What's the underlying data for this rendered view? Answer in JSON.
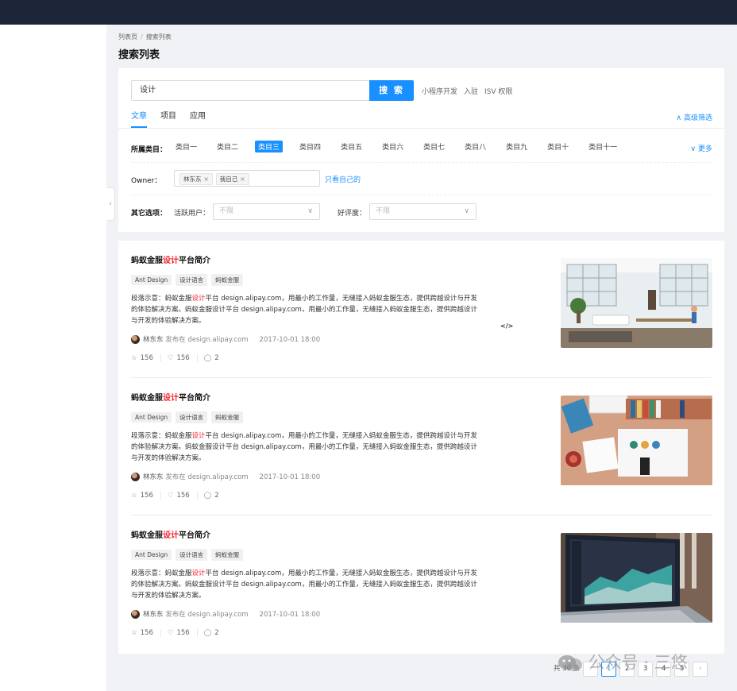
{
  "breadcrumb": [
    "列表页",
    "搜索列表"
  ],
  "page_title": "搜索列表",
  "search": {
    "value": "设计",
    "button": "搜 索"
  },
  "quick_links": [
    "小程序开发",
    "入驻",
    "ISV 权限"
  ],
  "tabs": [
    {
      "label": "文章",
      "active": true
    },
    {
      "label": "项目",
      "active": false
    },
    {
      "label": "应用",
      "active": false
    }
  ],
  "advanced_filter": "高级筛选",
  "filters": {
    "category_label": "所属类目：",
    "categories": [
      "类目一",
      "类目二",
      "类目三",
      "类目四",
      "类目五",
      "类目六",
      "类目七",
      "类目八",
      "类目九",
      "类目十",
      "类目十一"
    ],
    "selected_category": "类目三",
    "more": "更多",
    "owner_label": "Owner：",
    "owners": [
      "林东东",
      "我自己"
    ],
    "only_mine": "只看自己的",
    "other_label": "其它选项：",
    "active_user_label": "活跃用户：",
    "active_user_placeholder": "不限",
    "rating_label": "好评度：",
    "rating_placeholder": "不限"
  },
  "articles": [
    {
      "title_pre": "蚂蚁金服",
      "title_hl": "设计",
      "title_post": "平台简介",
      "tags": [
        "Ant Design",
        "设计语言",
        "蚂蚁金服"
      ],
      "desc_pre": "段落示意：蚂蚁金服",
      "desc_hl": "设计",
      "desc_post": "平台 design.alipay.com，用最小的工作量，无缝接入蚂蚁金服生态，提供跨越设计与开发的体验解决方案。蚂蚁金服设计平台 design.alipay.com，用最小的工作量，无缝接入蚂蚁金服生态，提供跨越设计与开发的体验解决方案。",
      "author": "林东东",
      "published": "发布在 design.alipay.com",
      "date": "2017-10-01 18:00",
      "stars": "156",
      "likes": "156",
      "comments": "2"
    },
    {
      "title_pre": "蚂蚁金服",
      "title_hl": "设计",
      "title_post": "平台简介",
      "tags": [
        "Ant Design",
        "设计语言",
        "蚂蚁金服"
      ],
      "desc_pre": "段落示意：蚂蚁金服",
      "desc_hl": "设计",
      "desc_post": "平台 design.alipay.com，用最小的工作量，无缝接入蚂蚁金服生态，提供跨越设计与开发的体验解决方案。蚂蚁金服设计平台 design.alipay.com，用最小的工作量，无缝接入蚂蚁金服生态，提供跨越设计与开发的体验解决方案。",
      "author": "林东东",
      "published": "发布在 design.alipay.com",
      "date": "2017-10-01 18:00",
      "stars": "156",
      "likes": "156",
      "comments": "2"
    },
    {
      "title_pre": "蚂蚁金服",
      "title_hl": "设计",
      "title_post": "平台简介",
      "tags": [
        "Ant Design",
        "设计语言",
        "蚂蚁金服"
      ],
      "desc_pre": "段落示意：蚂蚁金服",
      "desc_hl": "设计",
      "desc_post": "平台 design.alipay.com，用最小的工作量，无缝接入蚂蚁金服生态，提供跨越设计与开发的体验解决方案。蚂蚁金服设计平台 design.alipay.com，用最小的工作量，无缝接入蚂蚁金服生态，提供跨越设计与开发的体验解决方案。",
      "author": "林东东",
      "published": "发布在 design.alipay.com",
      "date": "2017-10-01 18:00",
      "stars": "156",
      "likes": "156",
      "comments": "2"
    }
  ],
  "pagination": {
    "total": "共 30 条",
    "pages": [
      "1",
      "2",
      "3",
      "4",
      "5"
    ],
    "current": "1"
  },
  "watermark": "公众号 · 三悠",
  "colors": {
    "primary": "#1890ff",
    "highlight": "#f5222d",
    "topbar": "#1d2639"
  }
}
